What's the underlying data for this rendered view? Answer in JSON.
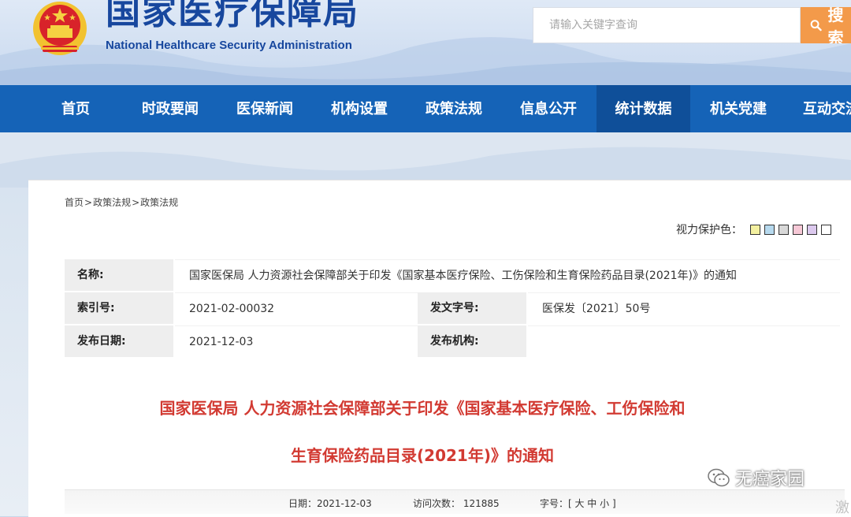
{
  "header": {
    "title_cn": "国家医疗保障局",
    "title_en": "National Healthcare Security Administration",
    "search_placeholder": "请输入关键字查询",
    "search_button": "搜索"
  },
  "nav": {
    "items": [
      {
        "label": "首页"
      },
      {
        "label": "时政要闻"
      },
      {
        "label": "医保新闻"
      },
      {
        "label": "机构设置"
      },
      {
        "label": "政策法规"
      },
      {
        "label": "信息公开"
      },
      {
        "label": "统计数据"
      },
      {
        "label": "机关党建"
      },
      {
        "label": "互动交流"
      }
    ],
    "active_index": 6
  },
  "breadcrumb": [
    "首页",
    "政策法规",
    "政策法规"
  ],
  "breadcrumb_sep": ">",
  "vision": {
    "label": "视力保护色：",
    "colors": [
      "#f3f0a0",
      "#b6d9ee",
      "#d8d8d8",
      "#f6c8d6",
      "#dcc9ee",
      "#ffffff"
    ]
  },
  "info": {
    "name_label": "名称:",
    "name_value": "国家医保局 人力资源社会保障部关于印发《国家基本医疗保险、工伤保险和生育保险药品目录(2021年)》的通知",
    "index_label": "索引号:",
    "index_value": "2021-02-00032",
    "docno_label": "发文字号:",
    "docno_value": "医保发〔2021〕50号",
    "date_label": "发布日期:",
    "date_value": "2021-12-03",
    "org_label": "发布机构:",
    "org_value": ""
  },
  "title": {
    "line1": "国家医保局 人力资源社会保障部关于印发《国家基本医疗保险、工伤保险和",
    "line2": "生育保险药品目录(2021年)》的通知"
  },
  "meta": {
    "date": "日期：2021-12-03",
    "visits": "访问次数：  121885",
    "font": "字号：[ 大 中 小 ]"
  },
  "watermark": {
    "text": "无癌家园",
    "corner": "激"
  },
  "colors": {
    "nav_bg": "#1563b7",
    "nav_active": "#0f4f99",
    "logo_blue": "#17479e",
    "title_red": "#d23a32",
    "search_orange": "#f39a4a"
  }
}
